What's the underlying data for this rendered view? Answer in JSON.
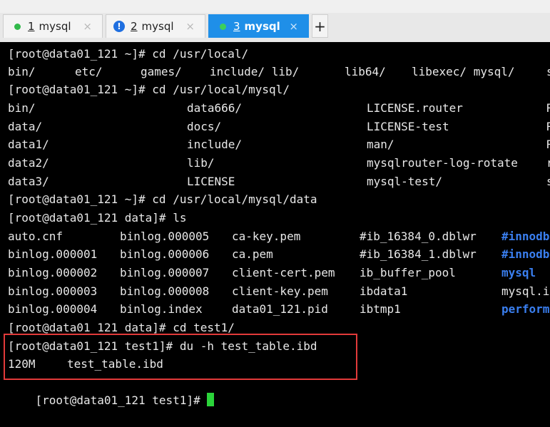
{
  "tabs": [
    {
      "number": "1",
      "label": "mysql",
      "close": "×",
      "status": "connected"
    },
    {
      "number": "2",
      "label": "mysql",
      "close": "×",
      "status": "warning"
    },
    {
      "number": "3",
      "label": "mysql",
      "close": "×",
      "status": "connected-active"
    }
  ],
  "add_tab": "+",
  "terminal": {
    "lines": [
      "[root@data01_121 ~]# cd /usr/local/",
      [
        "bin/",
        "etc/",
        "games/",
        "include/ lib/",
        "lib64/",
        "libexec/ mysql/",
        "s"
      ],
      "[root@data01_121 ~]# cd /usr/local/mysql/",
      [
        "bin/",
        "data666/",
        "LICENSE.router",
        "R"
      ],
      [
        "data/",
        "docs/",
        "LICENSE-test",
        "R"
      ],
      [
        "data1/",
        "include/",
        "man/",
        "R"
      ],
      [
        "data2/",
        "lib/",
        "mysqlrouter-log-rotate",
        "r"
      ],
      [
        "data3/",
        "LICENSE",
        "mysql-test/",
        "s"
      ],
      "[root@data01_121 ~]# cd /usr/local/mysql/data",
      "[root@data01_121 data]# ls",
      [
        "auto.cnf",
        "binlog.000005",
        "ca-key.pem",
        "#ib_16384_0.dblwr",
        "#innodb"
      ],
      [
        "binlog.000001",
        "binlog.000006",
        "ca.pem",
        "#ib_16384_1.dblwr",
        "#innodb"
      ],
      [
        "binlog.000002",
        "binlog.000007",
        "client-cert.pem",
        "ib_buffer_pool",
        "mysql"
      ],
      [
        "binlog.000003",
        "binlog.000008",
        "client-key.pem",
        "ibdata1",
        "mysql.i"
      ],
      [
        "binlog.000004",
        "binlog.index",
        "data01_121.pid",
        "ibtmp1",
        "perform"
      ],
      "[root@data01_121 data]# cd test1/",
      "[root@data01_121 test1]# du -h test_table.ibd",
      [
        "120M",
        "test_table.ibd"
      ],
      "[root@data01_121 test1]# "
    ]
  },
  "colors": {
    "active_tab": "#1f8fe8",
    "status_dot": "#31b94a",
    "directory_blue": "#3a7ff0",
    "highlight_box": "#e23a3a",
    "cursor": "#2bd43a"
  }
}
